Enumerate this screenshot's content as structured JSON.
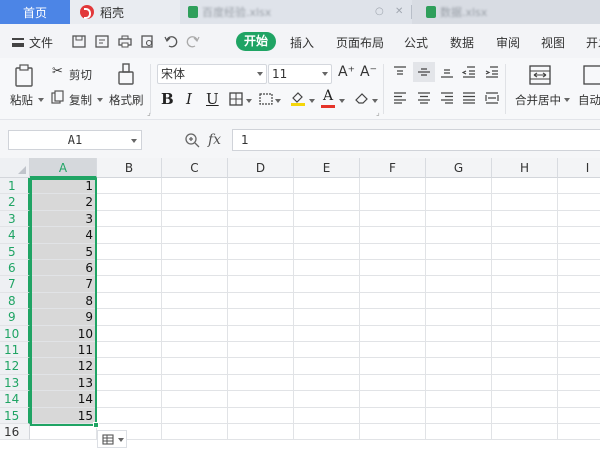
{
  "tabs": {
    "home": "首页",
    "daoke": "稻壳",
    "doc1": "百度经验.xlsx",
    "doc2": "数据.xlsx"
  },
  "menu": {
    "file": "文件",
    "start": "开始",
    "insert": "插入",
    "page_layout": "页面布局",
    "formulas": "公式",
    "data": "数据",
    "review": "审阅",
    "view": "视图",
    "more": "开发"
  },
  "ribbon": {
    "paste": "粘贴",
    "cut": "剪切",
    "copy": "复制",
    "format_painter": "格式刷",
    "font_name": "宋体",
    "font_size": "11",
    "bold": "B",
    "italic": "I",
    "underline": "U",
    "merge_center": "合并居中",
    "auto_wrap": "自动"
  },
  "formula_bar": {
    "name_box": "A1",
    "fx": "fx",
    "content": "1"
  },
  "sheet": {
    "columns": [
      "A",
      "B",
      "C",
      "D",
      "E",
      "F",
      "G",
      "H",
      "I"
    ],
    "row_numbers": [
      "1",
      "2",
      "3",
      "4",
      "5",
      "6",
      "7",
      "8",
      "9",
      "10",
      "11",
      "12",
      "13",
      "14",
      "15",
      "16"
    ],
    "col_a_values": [
      "1",
      "2",
      "3",
      "4",
      "5",
      "6",
      "7",
      "8",
      "9",
      "10",
      "11",
      "12",
      "13",
      "14",
      "15",
      ""
    ]
  },
  "colors": {
    "accent_green": "#1fa464",
    "home_tab_blue": "#4c85e6",
    "selection_fill": "#d8d8d8"
  }
}
